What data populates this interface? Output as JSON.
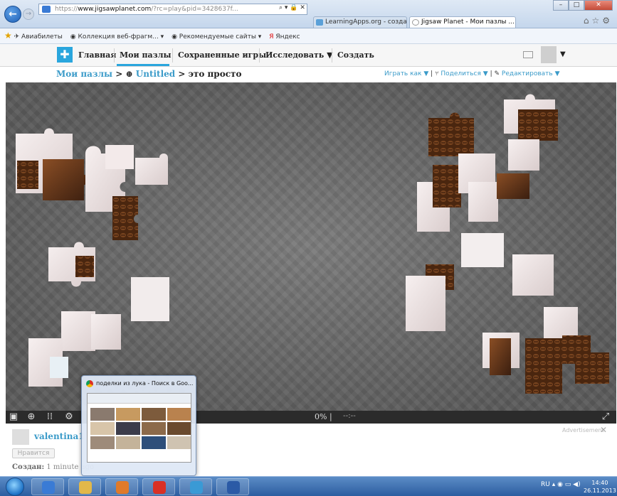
{
  "browser": {
    "address_prefix": "https://",
    "address_site": "www.jigsawplanet.com",
    "address_rest": "/?rc=play&pid=3428637f...",
    "address_tools": "⌕ ▾ 🔒 ✕",
    "tabs": [
      {
        "label": "LearningApps.org - создание ..."
      },
      {
        "label": "Jigsaw Planet - Мои пазлы ..."
      }
    ],
    "window_controls": [
      "–",
      "□",
      "✕"
    ]
  },
  "favorites": {
    "items": [
      {
        "label": "Авиабилеты",
        "icon": "plane-icon"
      },
      {
        "label": "Коллекция веб-фрагм... ▾",
        "icon": "ie-icon"
      },
      {
        "label": "Рекомендуемые сайты ▾",
        "icon": "ie-icon"
      },
      {
        "label": "Яндекс",
        "icon": "yandex-icon"
      }
    ]
  },
  "site_nav": {
    "items": [
      {
        "label": "Главная"
      },
      {
        "label": "Мои пазлы"
      },
      {
        "label": "Сохраненные игры"
      },
      {
        "label": "Исследовать ▼"
      },
      {
        "label": "Создать"
      }
    ],
    "account_caret": "▼"
  },
  "breadcrumb": {
    "root": "Мои пазлы",
    "sep1": " > ",
    "icon_glyph": "⊕",
    "album": "Untitled",
    "sep2": " > ",
    "current": "это просто"
  },
  "crumb_actions": {
    "play": "Играть как ▼",
    "share": "Поделиться ▼",
    "edit": "Редактировать ▼",
    "divider": "|"
  },
  "puzzle": {
    "progress": "0%",
    "separator": "|",
    "timer": "--:--",
    "colors": {
      "background": "#6c6c6c",
      "piece_light": "#efe6e6",
      "piece_brown": "#6b3a1c",
      "piece_dark": "#3a1e0f"
    }
  },
  "toolbar_icons": [
    "image-icon",
    "ghost-icon",
    "pieces-icon",
    "settings-icon",
    "fullscreen-icon"
  ],
  "meta": {
    "username": "valentina1",
    "like_label": "Нравится",
    "created_label": "Создан:",
    "created_value": "1 minute ago",
    "ad_label": "Advertisement",
    "ad_close": "✕"
  },
  "preview": {
    "title": "поделки из лука - Поиск в Goo...",
    "swatches": [
      "#8a7a6e",
      "#c79a60",
      "#7d5b3c",
      "#b9824e",
      "#d8c5a9",
      "#3c3c4a",
      "#8c6a4a",
      "#6a4a2e",
      "#9e8b7a",
      "#c4b39a",
      "#2e4f7a",
      "#cfc3b1"
    ]
  },
  "taskbar": {
    "apps": [
      {
        "name": "ie",
        "color": "#3a7bd5"
      },
      {
        "name": "explorer",
        "color": "#e2b84a"
      },
      {
        "name": "media",
        "color": "#e07a2a"
      },
      {
        "name": "chrome",
        "color": "#d93025"
      },
      {
        "name": "network",
        "color": "#3a9ad5"
      },
      {
        "name": "word",
        "color": "#2b5aa6"
      }
    ],
    "tray_lang": "RU",
    "tray_icons": "▴ ◉ ▭ ◀)",
    "clock_time": "14:40",
    "clock_date": "26.11.2013"
  }
}
